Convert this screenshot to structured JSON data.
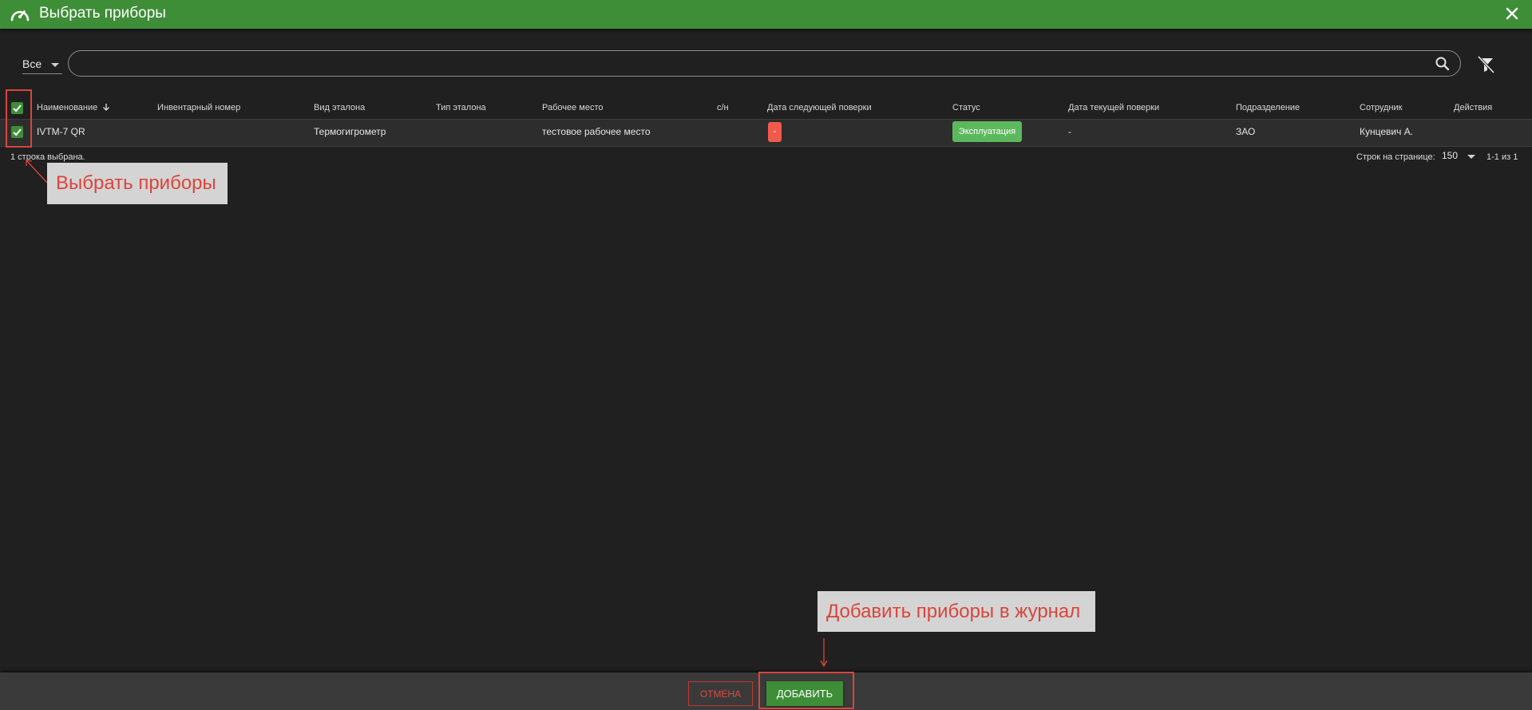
{
  "dialog": {
    "title": "Выбрать приборы",
    "icon": "gauge-icon",
    "close_icon": "close-icon"
  },
  "toolbar": {
    "filter_value": "Все",
    "search_value": "",
    "search_icon": "search-icon",
    "clear_filter_icon": "filter-off-icon"
  },
  "table": {
    "columns": [
      "Наименование",
      "Инвентарный номер",
      "Вид эталона",
      "Тип эталона",
      "Рабочее место",
      "с/н",
      "Дата следующей поверки",
      "Статус",
      "Дата текущей поверки",
      "Подразделение",
      "Сотрудник",
      "Действия"
    ],
    "sort_icon": "arrow-down-icon",
    "rows": [
      {
        "selected": true,
        "name": "IVTM-7 QR",
        "inventory_number": "",
        "standard_kind": "Термогигрометр",
        "standard_type": "",
        "workplace": "тестовое рабочее место",
        "serial": "",
        "next_check_date": "-",
        "status": "Эксплуатация",
        "current_check_date": "-",
        "department": "ЗАО",
        "employee": "Кунцевич А."
      }
    ]
  },
  "footer": {
    "selection_text": "1 строка выбрана.",
    "rows_per_page_label": "Строк на странице:",
    "rows_per_page_value": "150",
    "range_text": "1-1 из 1"
  },
  "annotations": {
    "select_label": "Выбрать приборы",
    "add_label": "Добавить приборы в журнал"
  },
  "actions": {
    "cancel_label": "Отмена",
    "add_label": "Добавить"
  },
  "colors": {
    "header_bar": "#3e8e37",
    "accent_green": "#3e8e37",
    "status_green": "#5cb85c",
    "danger_red": "#f15a4a",
    "annotation_red": "#d9453c",
    "background": "#202020"
  }
}
